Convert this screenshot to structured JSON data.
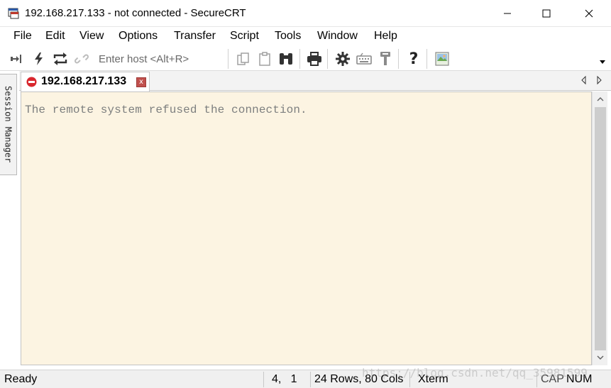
{
  "window": {
    "title": "192.168.217.133 - not connected - SecureCRT",
    "icon": "securecrt-app-icon"
  },
  "menu": {
    "items": [
      "File",
      "Edit",
      "View",
      "Options",
      "Transfer",
      "Script",
      "Tools",
      "Window",
      "Help"
    ]
  },
  "toolbar": {
    "host_placeholder": "Enter host <Alt+R>",
    "icons": [
      "connect-icon",
      "quick-connect-icon",
      "reconnect-icon",
      "disconnect-icon",
      "copy-icon",
      "paste-icon",
      "find-icon",
      "print-icon",
      "settings-icon",
      "keymap-icon",
      "sftp-icon",
      "help-icon",
      "screenshot-icon"
    ]
  },
  "session_manager": {
    "label": "Session Manager"
  },
  "tabs": [
    {
      "label": "192.168.217.133",
      "status": "disconnected",
      "close_label": "x"
    }
  ],
  "terminal": {
    "lines": [
      "The remote system refused the connection."
    ],
    "background": "#fcf4e2",
    "text_color": "#7d7f7f"
  },
  "status_bar": {
    "state": "Ready",
    "cursor": "4,   1",
    "size": "24 Rows, 80 Cols",
    "emulation": "Xterm",
    "caps": "CAP",
    "num": "NUM"
  },
  "watermark": "https://blog.csdn.net/qq_35981599"
}
